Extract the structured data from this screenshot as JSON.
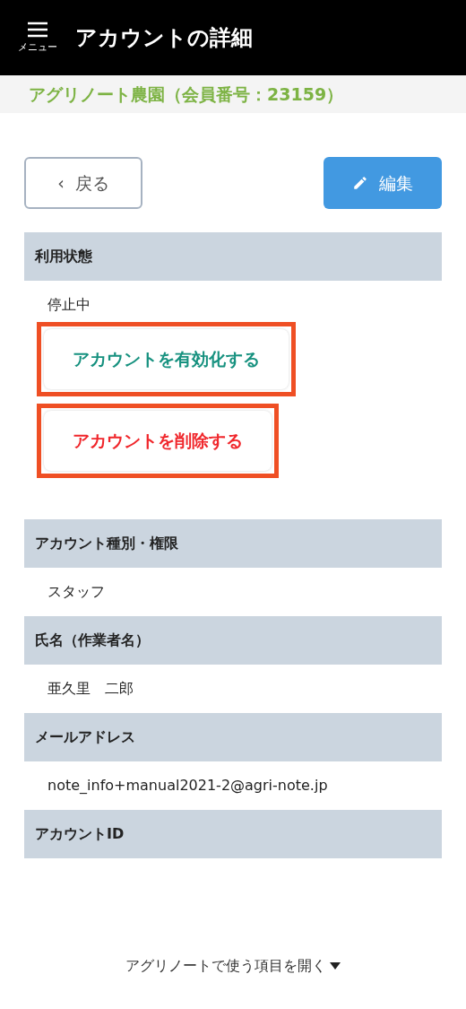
{
  "header": {
    "menu_label": "メニュー",
    "title": "アカウントの詳細"
  },
  "subheader": "アグリノート農園（会員番号：23159）",
  "toolbar": {
    "back": {
      "icon": "‹",
      "label": "戻る"
    },
    "edit": "編集"
  },
  "sections": [
    {
      "label": "利用状態",
      "value": "停止中",
      "actions": [
        {
          "kind": "activate",
          "label": "アカウントを有効化する",
          "highlighted": true
        },
        {
          "kind": "delete",
          "label": "アカウントを削除する",
          "highlighted": true
        }
      ]
    },
    {
      "label": "アカウント種別・権限",
      "value": "スタッフ"
    },
    {
      "label": "氏名（作業者名）",
      "value": "亜久里　二郎"
    },
    {
      "label": "メールアドレス",
      "value": "note_info+manual2021-2@agri-note.jp"
    },
    {
      "label": "アカウントID"
    }
  ],
  "footer_link": "アグリノートで使う項目を開く"
}
